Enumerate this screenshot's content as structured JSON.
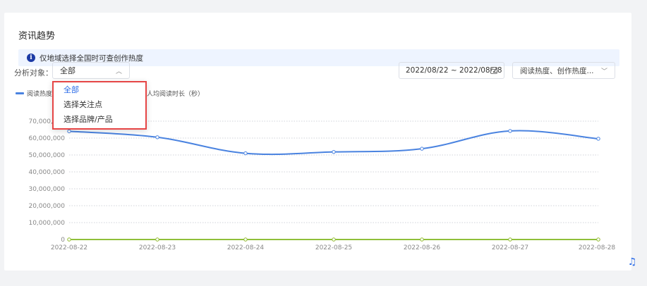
{
  "section": {
    "title": "资讯趋势",
    "notice": "仅地域选择全国时可查创作热度"
  },
  "filters": {
    "target_label": "分析对象：",
    "target_selected": "全部",
    "target_options": [
      "全部",
      "选择关注点",
      "选择品牌/产品"
    ],
    "date_range": "2022/08/22 ~ 2022/08/28",
    "metrics_selected": "阅读热度、创作热度..."
  },
  "legend": {
    "series1": "阅读热度",
    "series3": "人均阅读时长（秒）"
  },
  "colors": {
    "read_heat": "#4a83e0",
    "creation": "#8fbf3a",
    "avg_time": "#f0b429",
    "accent": "#2a6be8",
    "highlight_border": "#e64545"
  },
  "chart_data": {
    "type": "line",
    "x": [
      "2022-08-22",
      "2022-08-23",
      "2022-08-24",
      "2022-08-25",
      "2022-08-26",
      "2022-08-27",
      "2022-08-28"
    ],
    "y_ticks": [
      "0",
      "10,000,000",
      "20,000,000",
      "30,000,000",
      "40,000,000",
      "50,000,000",
      "60,000,000",
      "70,000,000"
    ],
    "ylim": [
      0,
      70000000
    ],
    "grid": true,
    "series": [
      {
        "name": "阅读热度",
        "color": "#4a83e0",
        "values": [
          64000000,
          60500000,
          51000000,
          51800000,
          53700000,
          64200000,
          59600000
        ]
      },
      {
        "name": "",
        "color": "#8fbf3a",
        "values": [
          0,
          0,
          0,
          0,
          0,
          0,
          0
        ]
      },
      {
        "name": "人均阅读时长（秒）",
        "color": "#f0b429",
        "values": [
          0,
          0,
          0,
          0,
          0,
          0,
          0
        ]
      }
    ]
  },
  "help_icon": "help-headset-icon"
}
